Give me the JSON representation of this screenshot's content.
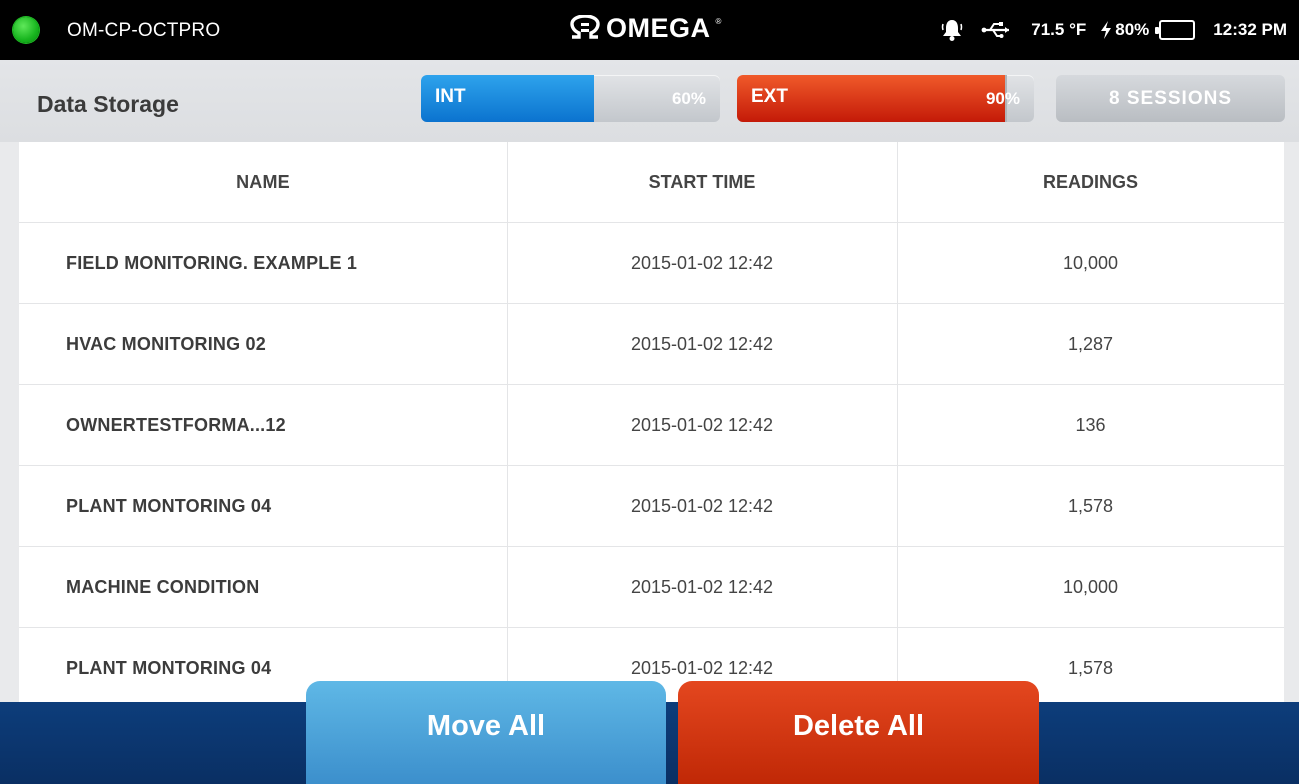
{
  "status_bar": {
    "device_name": "OM-CP-OCTPRO",
    "brand": "OMEGA",
    "temperature": "71.5 °F",
    "battery_percent": "80%",
    "battery_level": 0.8,
    "time": "12:32 PM",
    "connection_color": "#1fbf24",
    "icons": [
      "status-dot-icon",
      "omega-logo-icon",
      "alarm-bell-icon",
      "usb-icon",
      "charging-bolt-icon",
      "battery-icon"
    ]
  },
  "header": {
    "title": "Data Storage",
    "internal": {
      "label": "INT",
      "percent_text": "60%",
      "fill_fraction": 0.58,
      "color": "#0b73cf"
    },
    "external": {
      "label": "EXT",
      "percent_text": "90%",
      "fill_fraction": 0.91,
      "color": "#d8260d"
    },
    "sessions_label": "8 SESSIONS"
  },
  "table": {
    "columns": [
      "NAME",
      "START TIME",
      "READINGS"
    ],
    "rows": [
      {
        "name": "FIELD MONITORING. EXAMPLE 1",
        "start_time": "2015-01-02 12:42",
        "readings": "10,000"
      },
      {
        "name": "HVAC MONITORING 02",
        "start_time": "2015-01-02 12:42",
        "readings": "1,287"
      },
      {
        "name": "OWNERTESTFORMA...12",
        "start_time": "2015-01-02 12:42",
        "readings": "136"
      },
      {
        "name": "PLANT MONTORING 04",
        "start_time": "2015-01-02 12:42",
        "readings": "1,578"
      },
      {
        "name": "MACHINE CONDITION",
        "start_time": "2015-01-02 12:42",
        "readings": "10,000"
      },
      {
        "name": "PLANT MONTORING 04",
        "start_time": "2015-01-02 12:42",
        "readings": "1,578"
      }
    ]
  },
  "footer": {
    "move_label": "Move All",
    "delete_label": "Delete All"
  }
}
